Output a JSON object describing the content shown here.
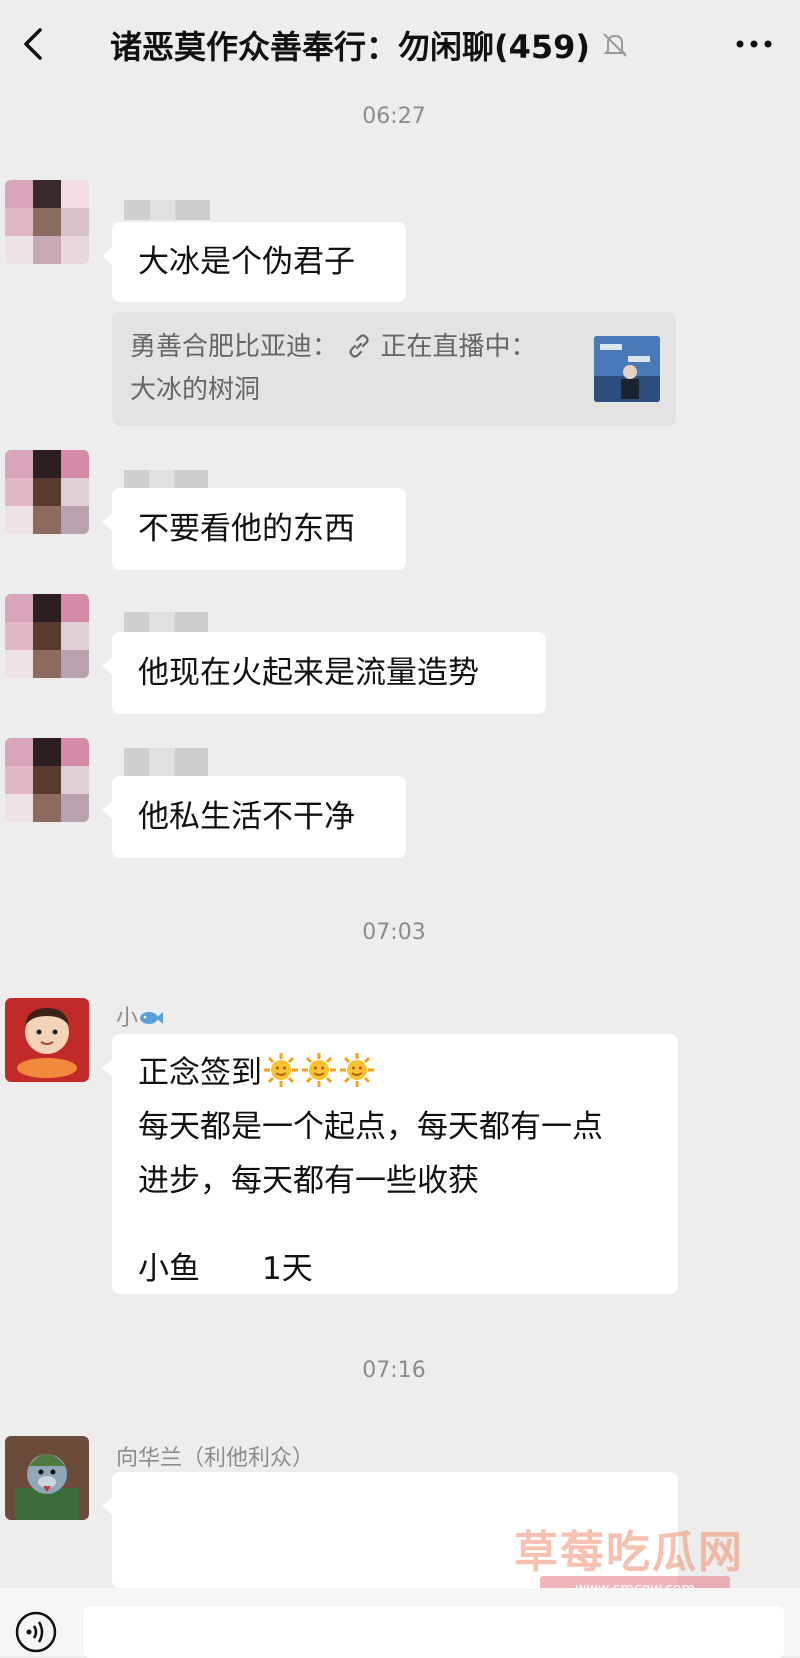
{
  "header": {
    "title": "诸恶莫作众善奉行：勿闲聊(459)",
    "back_icon": "chevron-left-icon",
    "mute_icon": "bell-off-icon",
    "more_icon": "more-dots-icon"
  },
  "timestamps": [
    "06:27",
    "07:03",
    "07:16"
  ],
  "messages": [
    {
      "text": "大冰是个伪君子"
    },
    {
      "text": "不要看他的东西"
    },
    {
      "text": "他现在火起来是流量造势"
    },
    {
      "text": "他私生活不干净"
    },
    {
      "sender": "小",
      "sender_icon": "fish-icon",
      "line1": "正念签到",
      "line2": "每天都是一个起点，每天都有一点",
      "line3": "进步，每天都有一些收获",
      "line4": "小鱼　　1天"
    },
    {
      "sender": "向华兰（利他利众）",
      "text": ""
    }
  ],
  "quote": {
    "line1": "勇善合肥比亚迪：",
    "link_icon": "link-icon",
    "line1b": "正在直播中：",
    "line2": "大冰的树洞"
  },
  "watermark": {
    "text": "草莓吃瓜网",
    "url": "www.cmcgw.com"
  },
  "colors": {
    "background": "#ededed",
    "bubble": "#ffffff",
    "meta_text": "#8c8c8c"
  }
}
